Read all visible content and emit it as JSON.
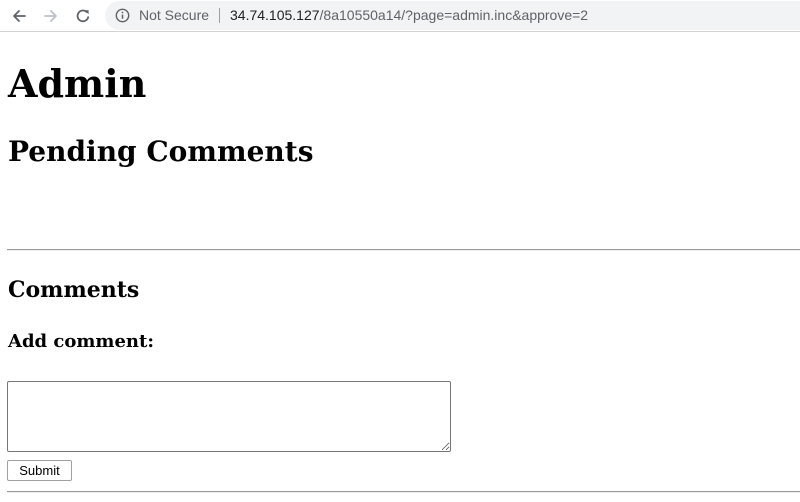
{
  "browser": {
    "security_label": "Not Secure",
    "url_host": "34.74.105.127",
    "url_path": "/8a10550a14/?page=admin.inc&approve=2",
    "icons": {
      "back": "arrow-left-icon",
      "forward": "arrow-right-icon",
      "reload": "reload-icon",
      "info": "info-circle-icon"
    },
    "colors": {
      "omnibox_bg": "#f1f3f4",
      "path_text": "#5f6368",
      "host_text": "#202124"
    }
  },
  "page": {
    "title": "Admin",
    "pending_heading": "Pending Comments",
    "comments_heading": "Comments",
    "add_comment_label": "Add comment:",
    "comment_value": "",
    "submit_label": "Submit"
  }
}
